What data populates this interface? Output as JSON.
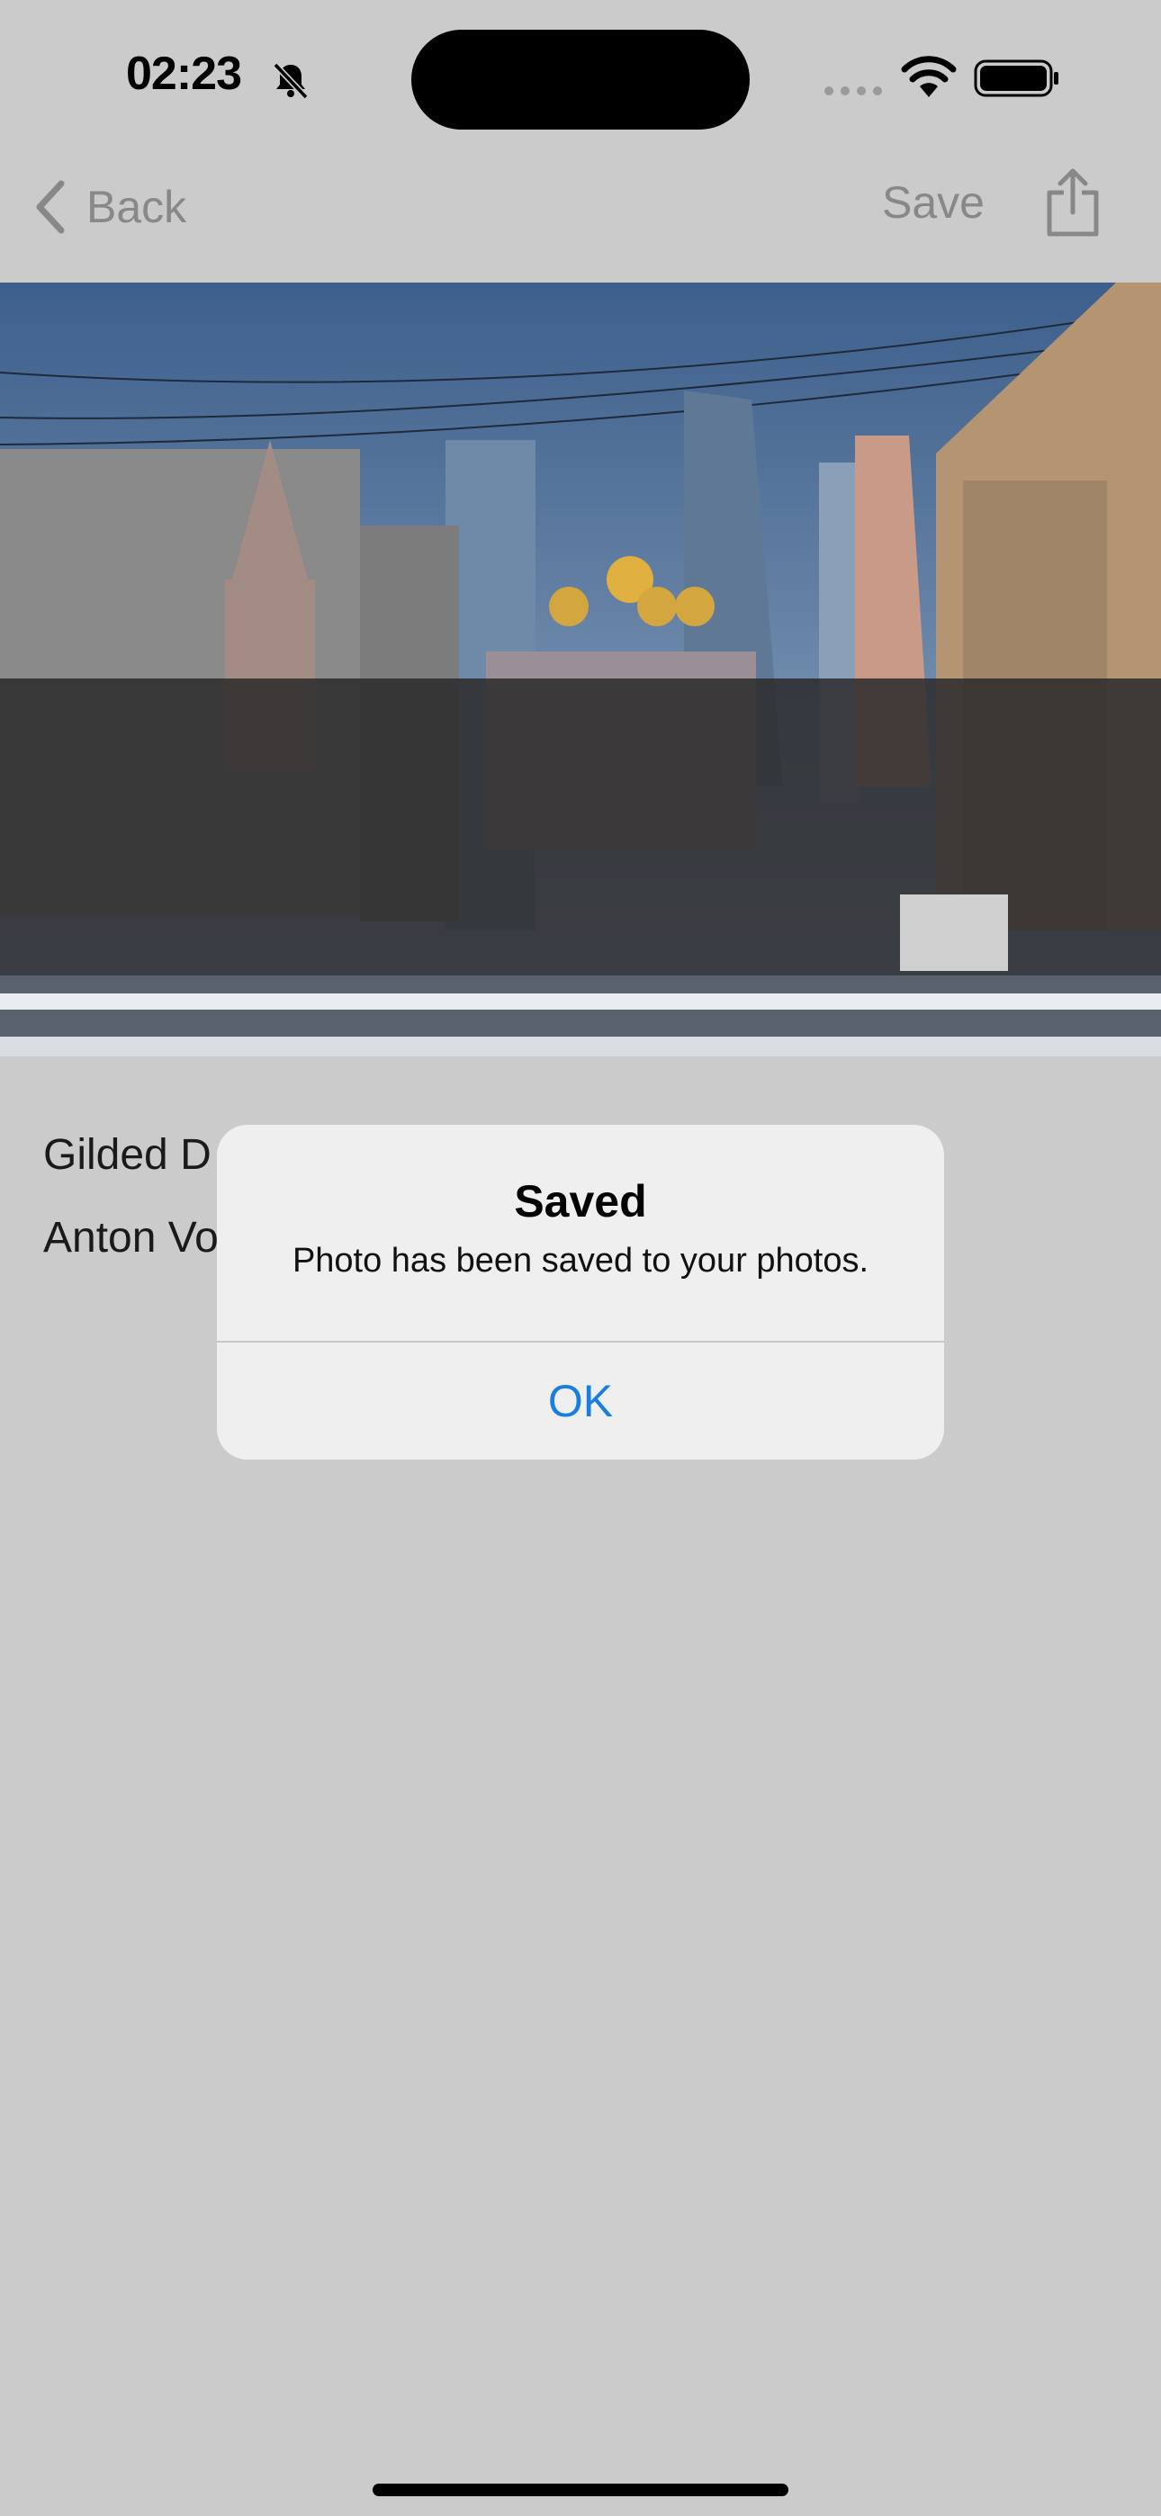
{
  "status_bar": {
    "time": "02:23"
  },
  "nav": {
    "back_label": "Back",
    "save_label": "Save"
  },
  "photo": {
    "title": "Gilded D",
    "author": "Anton Vo"
  },
  "alert": {
    "title": "Saved",
    "message": "Photo has been saved to your photos.",
    "ok_label": "OK"
  },
  "colors": {
    "accent": "#1a7de0",
    "dim_background": "#cbcbcb",
    "alert_bg": "#efefef"
  }
}
